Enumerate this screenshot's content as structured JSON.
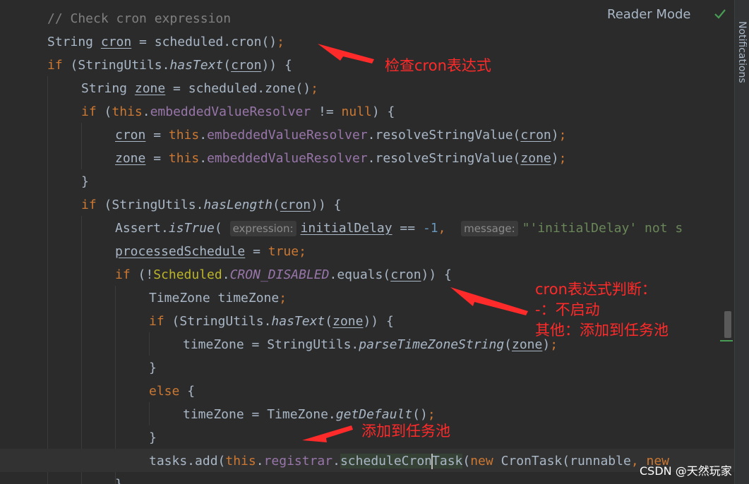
{
  "header": {
    "reader_mode": "Reader Mode",
    "notifications": "Notifications"
  },
  "code": {
    "comment": "// Check cron expression",
    "hint_expression": "expression:",
    "hint_message": "message:",
    "initial_delay_msg": "\"'initialDelay' not s",
    "cron_disabled": "CRON_DISABLED",
    "minus_one": "-1"
  },
  "annotations": {
    "check_cron": "检查cron表达式",
    "cron_judge_line1": "cron表达式判断：",
    "cron_judge_line2": "-：不启动",
    "cron_judge_line3": "其他：添加到任务池",
    "add_to_pool": "添加到任务池"
  },
  "watermark": "CSDN @天然玩家",
  "colors": {
    "background": "#2b2b2b",
    "keyword": "#cc7832",
    "field": "#9876aa",
    "string": "#6a8759",
    "annotation_red": "#ff2a2a"
  }
}
